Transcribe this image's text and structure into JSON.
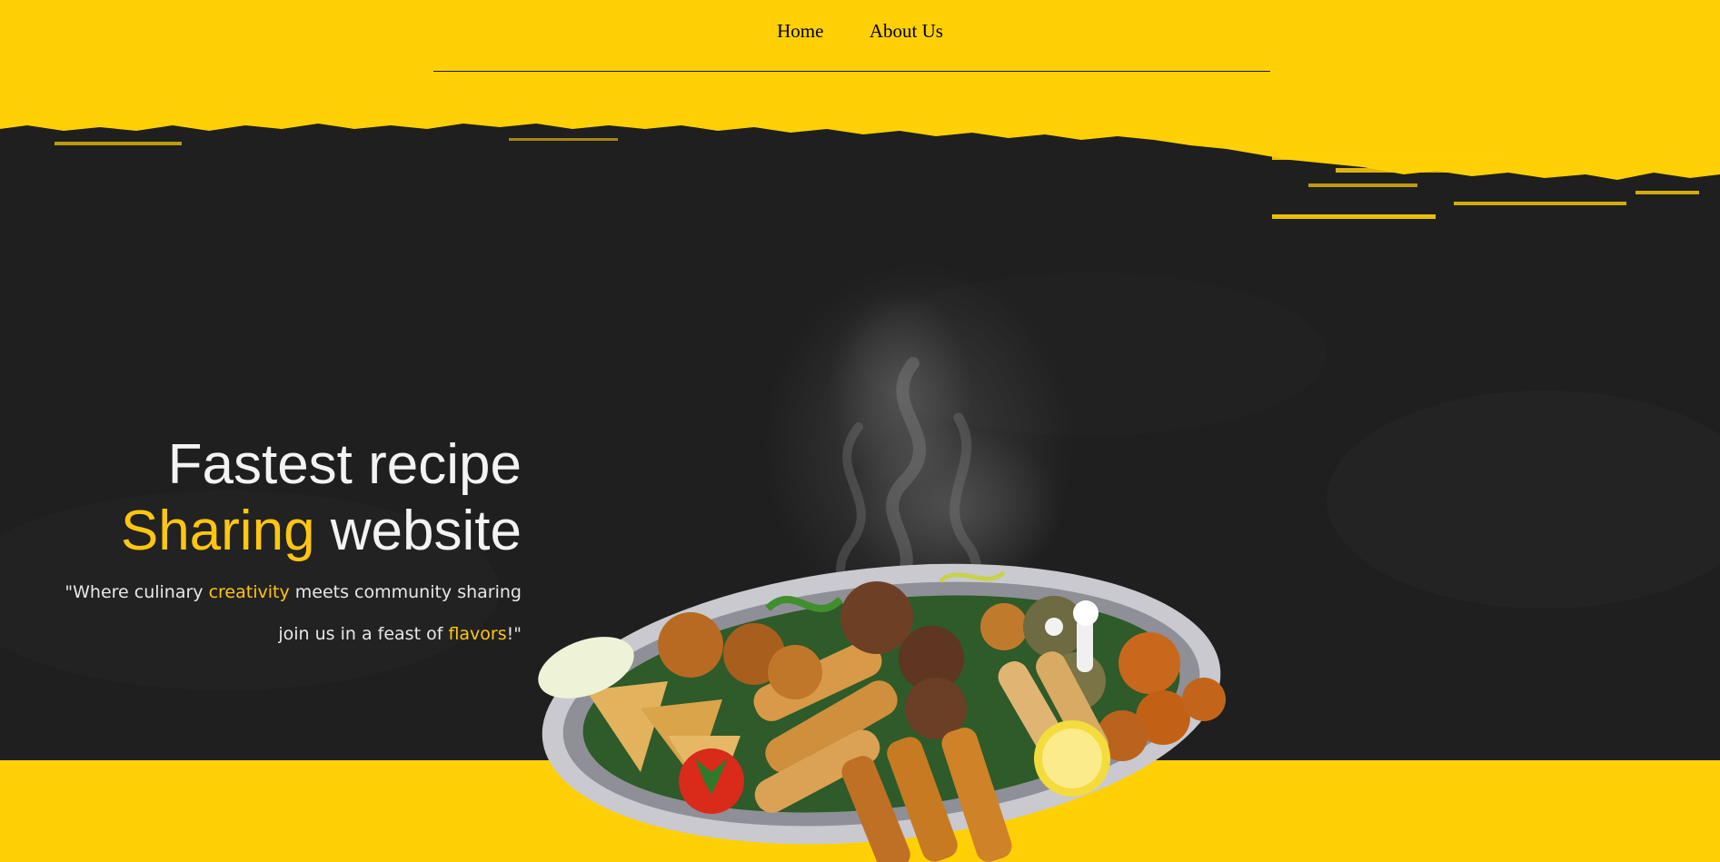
{
  "nav": {
    "links": [
      {
        "label": "Home"
      },
      {
        "label": "About Us"
      }
    ]
  },
  "hero": {
    "headline_line1": "Fastest recipe",
    "headline_line2_accent": "Sharing",
    "headline_line2_rest": " website",
    "tagline": {
      "part1": "\"Where culinary ",
      "accent1": "creativity",
      "part2": " meets community sharing",
      "part3": "join us in a feast of ",
      "accent2": "flavors",
      "part4": "!\""
    }
  },
  "colors": {
    "brand_yellow": "#ffd005",
    "dark_background": "#1e1e1e",
    "accent_text": "#ffc611",
    "light_text": "#f3f3f3"
  },
  "images": {
    "hero_dish": "platter of fried snacks, spring rolls, samosas and falafel with rising steam"
  }
}
